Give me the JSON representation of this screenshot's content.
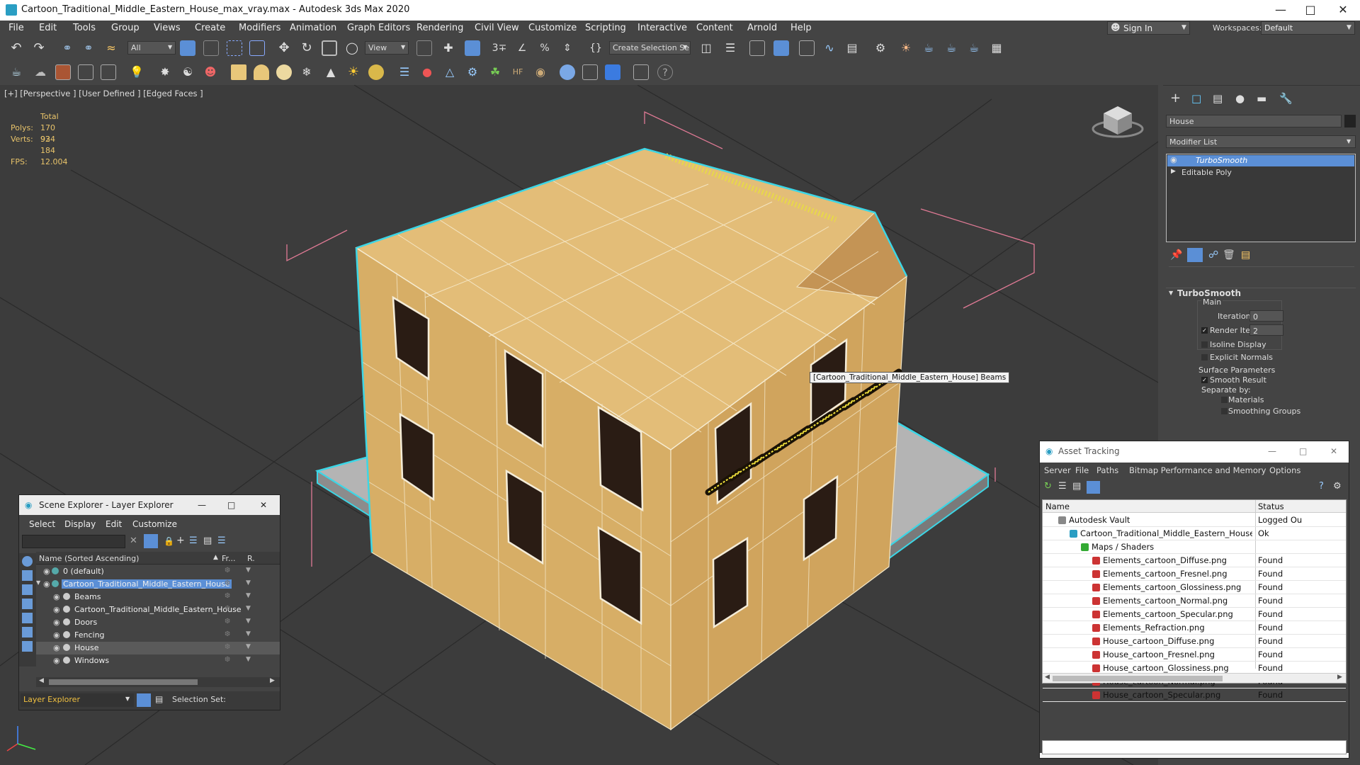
{
  "window": {
    "title": "Cartoon_Traditional_Middle_Eastern_House_max_vray.max - Autodesk 3ds Max 2020"
  },
  "menu": [
    "File",
    "Edit",
    "Tools",
    "Group",
    "Views",
    "Create",
    "Modifiers",
    "Animation",
    "Graph Editors",
    "Rendering",
    "Civil View",
    "Customize",
    "Scripting",
    "Interactive",
    "Content",
    "Arnold",
    "Help"
  ],
  "account": {
    "sign_in": "Sign In",
    "workspaces_label": "Workspaces:",
    "workspace": "Default"
  },
  "toolbar": {
    "filter": "All",
    "ref_coord": "View",
    "selection_set": "Create Selection Se"
  },
  "viewport": {
    "label": "[+] [Perspective ] [User Defined ] [Edged Faces ]",
    "stats": {
      "total": "Total",
      "polys_label": "Polys:",
      "polys": "170 934",
      "verts_label": "Verts:",
      "verts": "92 184",
      "fps_label": "FPS:",
      "fps": "12.004"
    },
    "tooltip": "[Cartoon_Traditional_Middle_Eastern_House] Beams"
  },
  "command_panel": {
    "object_name": "House",
    "modifier_list": "Modifier List",
    "stack": [
      "TurboSmooth",
      "Editable Poly"
    ],
    "rollout_title": "TurboSmooth",
    "main": "Main",
    "iterations_label": "Iterations:",
    "iterations": "0",
    "render_iters_label": "Render Iters:",
    "render_iters": "2",
    "isoline": "Isoline Display",
    "explicit_normals": "Explicit Normals",
    "surface_params": "Surface Parameters",
    "smooth_result": "Smooth Result",
    "separate_by": "Separate by:",
    "materials": "Materials",
    "smoothing_groups": "Smoothing Groups"
  },
  "scene_explorer": {
    "title": "Scene Explorer - Layer Explorer",
    "menu": [
      "Select",
      "Display",
      "Edit",
      "Customize"
    ],
    "col_name": "Name (Sorted Ascending)",
    "col_fr": "Fr...",
    "col_r": "R.",
    "rows": [
      {
        "label": "0 (default)",
        "indent": 0,
        "type": "layer",
        "selected": false
      },
      {
        "label": "Cartoon_Traditional_Middle_Eastern_House",
        "indent": 0,
        "type": "layer",
        "selected": true
      },
      {
        "label": "Beams",
        "indent": 1,
        "type": "obj",
        "selected": false
      },
      {
        "label": "Cartoon_Traditional_Middle_Eastern_House",
        "indent": 1,
        "type": "grp",
        "selected": false
      },
      {
        "label": "Doors",
        "indent": 1,
        "type": "obj",
        "selected": false
      },
      {
        "label": "Fencing",
        "indent": 1,
        "type": "obj",
        "selected": false
      },
      {
        "label": "House",
        "indent": 1,
        "type": "obj",
        "selected": false,
        "highlight": true
      },
      {
        "label": "Windows",
        "indent": 1,
        "type": "obj",
        "selected": false
      }
    ],
    "footer_mode": "Layer Explorer",
    "selection_set": "Selection Set:"
  },
  "asset_tracking": {
    "title": "Asset Tracking",
    "menu": [
      "Server",
      "File",
      "Paths",
      "Bitmap Performance and Memory",
      "Options"
    ],
    "col_name": "Name",
    "col_status": "Status",
    "rows": [
      {
        "label": "Autodesk Vault",
        "status": "Logged Ou",
        "indent": 0,
        "icon": "vault"
      },
      {
        "label": "Cartoon_Traditional_Middle_Eastern_House_max_vray.max",
        "status": "Ok",
        "indent": 1,
        "icon": "max"
      },
      {
        "label": "Maps / Shaders",
        "status": "",
        "indent": 2,
        "icon": "maps"
      },
      {
        "label": "Elements_cartoon_Diffuse.png",
        "status": "Found",
        "indent": 3,
        "icon": "png"
      },
      {
        "label": "Elements_cartoon_Fresnel.png",
        "status": "Found",
        "indent": 3,
        "icon": "png"
      },
      {
        "label": "Elements_cartoon_Glossiness.png",
        "status": "Found",
        "indent": 3,
        "icon": "png"
      },
      {
        "label": "Elements_cartoon_Normal.png",
        "status": "Found",
        "indent": 3,
        "icon": "png"
      },
      {
        "label": "Elements_cartoon_Specular.png",
        "status": "Found",
        "indent": 3,
        "icon": "png"
      },
      {
        "label": "Elements_Refraction.png",
        "status": "Found",
        "indent": 3,
        "icon": "png"
      },
      {
        "label": "House_cartoon_Diffuse.png",
        "status": "Found",
        "indent": 3,
        "icon": "png"
      },
      {
        "label": "House_cartoon_Fresnel.png",
        "status": "Found",
        "indent": 3,
        "icon": "png"
      },
      {
        "label": "House_cartoon_Glossiness.png",
        "status": "Found",
        "indent": 3,
        "icon": "png"
      },
      {
        "label": "House_cartoon_Normal.png",
        "status": "Found",
        "indent": 3,
        "icon": "png"
      },
      {
        "label": "House_cartoon_Specular.png",
        "status": "Found",
        "indent": 3,
        "icon": "png"
      }
    ]
  },
  "colors": {
    "accent": "#5b8fd6",
    "selection_cyan": "#3cd6e6",
    "wall": "#d8b06a",
    "stats": "#e8c36a"
  }
}
